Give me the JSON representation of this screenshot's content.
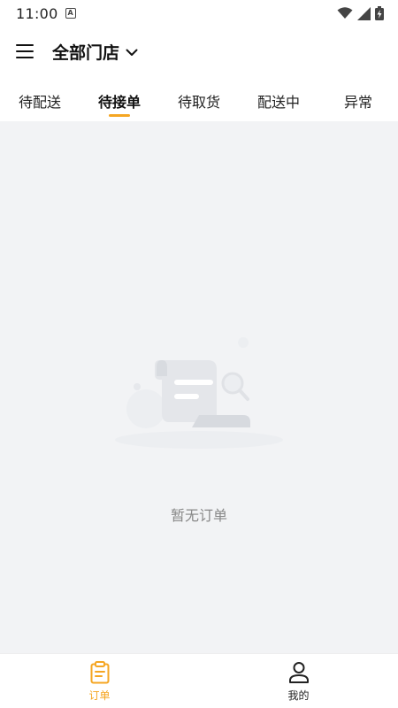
{
  "status_bar": {
    "time": "11:00",
    "notification_icon": "a-box-icon",
    "icons": [
      "wifi-icon",
      "signal-icon",
      "battery-charging-icon"
    ]
  },
  "header": {
    "menu_icon": "menu-icon",
    "store_selector": "全部门店",
    "chevron_icon": "chevron-down-icon"
  },
  "tabs": [
    {
      "label": "待配送",
      "active": false
    },
    {
      "label": "待接单",
      "active": true
    },
    {
      "label": "待取货",
      "active": false
    },
    {
      "label": "配送中",
      "active": false
    },
    {
      "label": "异常",
      "active": false
    }
  ],
  "empty_state": {
    "illustration": "empty-document-icon",
    "message": "暂无订单"
  },
  "bottom_nav": [
    {
      "label": "订单",
      "icon": "clipboard-icon",
      "active": true
    },
    {
      "label": "我的",
      "icon": "person-icon",
      "active": false
    }
  ],
  "colors": {
    "accent": "#f5a623",
    "content_background": "#f2f3f5",
    "empty_text": "#888888"
  }
}
